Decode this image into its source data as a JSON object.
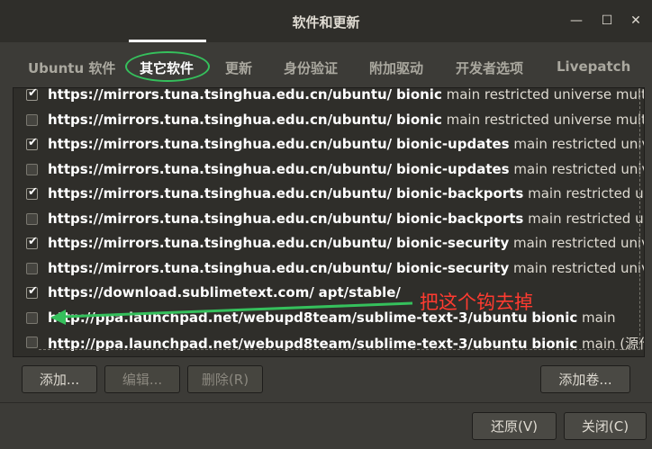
{
  "window": {
    "title": "软件和更新",
    "minimize_glyph": "—",
    "maximize_glyph": "☐",
    "close_glyph": "✕"
  },
  "tabs": [
    {
      "label": "Ubuntu 软件",
      "active": false
    },
    {
      "label": "其它软件",
      "active": true
    },
    {
      "label": "更新",
      "active": false
    },
    {
      "label": "身份验证",
      "active": false
    },
    {
      "label": "附加驱动",
      "active": false
    },
    {
      "label": "开发者选项",
      "active": false
    },
    {
      "label": "Livepatch",
      "active": false
    }
  ],
  "sources": [
    {
      "checked": true,
      "url": "https://mirrors.tuna.tsinghua.edu.cn/ubuntu/",
      "suite": "bionic",
      "components": "main restricted universe multiverse"
    },
    {
      "checked": false,
      "url": "https://mirrors.tuna.tsinghua.edu.cn/ubuntu/",
      "suite": "bionic",
      "components": "main restricted universe multiverse"
    },
    {
      "checked": true,
      "url": "https://mirrors.tuna.tsinghua.edu.cn/ubuntu/",
      "suite": "bionic-updates",
      "components": "main restricted universe m"
    },
    {
      "checked": false,
      "url": "https://mirrors.tuna.tsinghua.edu.cn/ubuntu/",
      "suite": "bionic-updates",
      "components": "main restricted universe m"
    },
    {
      "checked": true,
      "url": "https://mirrors.tuna.tsinghua.edu.cn/ubuntu/",
      "suite": "bionic-backports",
      "components": "main restricted univers"
    },
    {
      "checked": false,
      "url": "https://mirrors.tuna.tsinghua.edu.cn/ubuntu/",
      "suite": "bionic-backports",
      "components": "main restricted univers"
    },
    {
      "checked": true,
      "url": "https://mirrors.tuna.tsinghua.edu.cn/ubuntu/",
      "suite": "bionic-security",
      "components": "main restricted universe m"
    },
    {
      "checked": false,
      "url": "https://mirrors.tuna.tsinghua.edu.cn/ubuntu/",
      "suite": "bionic-security",
      "components": "main restricted universe m"
    },
    {
      "checked": true,
      "url": "https://download.sublimetext.com/",
      "suite": "apt/stable/",
      "components": ""
    },
    {
      "checked": false,
      "url": "http://ppa.launchpad.net/webupd8team/sublime-text-3/ubuntu",
      "suite": "bionic",
      "components": "main"
    },
    {
      "checked": false,
      "url": "http://ppa.launchpad.net/webupd8team/sublime-text-3/ubuntu",
      "suite": "bionic",
      "components": "main (源代码)"
    }
  ],
  "annotation": {
    "text": "把这个钩去掉",
    "color": "#ff3b30",
    "ellipse_color": "#35c05c",
    "arrow_color": "#35c05c"
  },
  "buttons": {
    "add": "添加...",
    "edit": "编辑...",
    "remove": "删除(R)",
    "add_volume": "添加卷...",
    "revert": "还原(V)",
    "close": "关闭(C)"
  }
}
